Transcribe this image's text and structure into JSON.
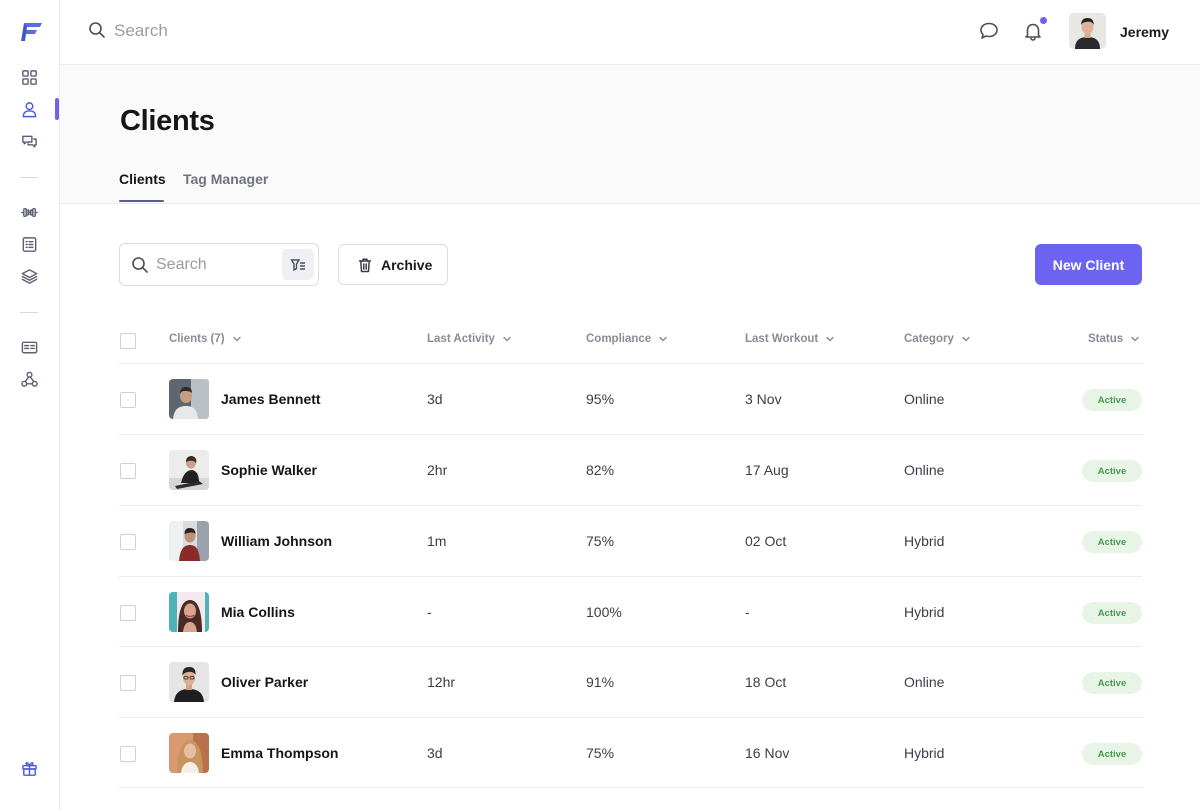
{
  "topbar": {
    "search_placeholder": "Search",
    "user_name": "Jeremy"
  },
  "header": {
    "title": "Clients",
    "tabs": [
      {
        "label": "Clients",
        "active": true
      },
      {
        "label": "Tag Manager",
        "active": false
      }
    ]
  },
  "toolbar": {
    "search_placeholder": "Search",
    "archive_label": "Archive",
    "new_client_label": "New Client"
  },
  "table": {
    "columns": [
      "Clients (7)",
      "Last Activity",
      "Compliance",
      "Last Workout",
      "Category",
      "Status"
    ],
    "rows": [
      {
        "name": "James Bennett",
        "last_activity": "3d",
        "compliance": "95%",
        "last_workout": "3 Nov",
        "category": "Online",
        "status": "Active"
      },
      {
        "name": "Sophie Walker",
        "last_activity": "2hr",
        "compliance": "82%",
        "last_workout": "17 Aug",
        "category": "Online",
        "status": "Active"
      },
      {
        "name": "William Johnson",
        "last_activity": "1m",
        "compliance": "75%",
        "last_workout": "02 Oct",
        "category": "Hybrid",
        "status": "Active"
      },
      {
        "name": "Mia Collins",
        "last_activity": "-",
        "compliance": "100%",
        "last_workout": "-",
        "category": "Hybrid",
        "status": "Active"
      },
      {
        "name": "Oliver Parker",
        "last_activity": "12hr",
        "compliance": "91%",
        "last_workout": "18 Oct",
        "category": "Online",
        "status": "Active"
      },
      {
        "name": "Emma Thompson",
        "last_activity": "3d",
        "compliance": "75%",
        "last_workout": "16 Nov",
        "category": "Hybrid",
        "status": "Active"
      }
    ]
  },
  "sidebar": {
    "icons": [
      "dashboard-icon",
      "clients-icon",
      "messages-icon",
      "workouts-icon",
      "programs-icon",
      "library-icon",
      "billing-icon",
      "integrations-icon",
      "gift-icon"
    ],
    "active": "clients-icon"
  },
  "colors": {
    "accent": "#6c63f0",
    "status_active_bg": "#e8f5e6",
    "status_active_text": "#4a9a4e"
  }
}
